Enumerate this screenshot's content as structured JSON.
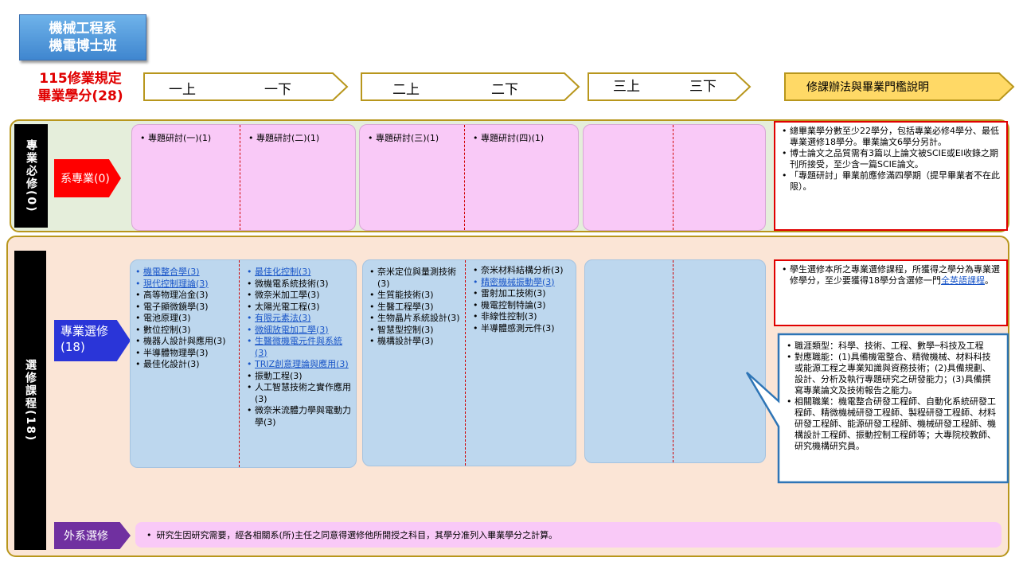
{
  "title": {
    "line1": "機械工程系",
    "line2": "機電博士班"
  },
  "credits_title": {
    "line1": "115修業規定",
    "line2": "畢業學分(28)"
  },
  "headers": {
    "year1": {
      "first": "一上",
      "second": "一下"
    },
    "year2": {
      "first": "二上",
      "second": "二下"
    },
    "year3": {
      "first": "三上",
      "second": "三下"
    },
    "notes": "修課辦法與畢業門檻說明"
  },
  "required": {
    "side_label": "專業必修(0)",
    "dept_tab": "系專業(0)",
    "y1_first": [
      "專題研討(一)(1)"
    ],
    "y1_second": [
      "專題研討(二)(1)"
    ],
    "y2_first": [
      "專題研討(三)(1)"
    ],
    "y2_second": [
      "專題研討(四)(1)"
    ],
    "notes": [
      "總畢業學分數至少22學分，包括專業必修4學分、最低專業選修18學分。畢業論文6學分另計。",
      "博士論文之品質需有3篇以上論文被SCIE或EI收錄之期刊所接受，至少含一篇SCIE論文。",
      "「專題研討」畢業前應修滿四學期（提早畢業者不在此限）。"
    ]
  },
  "elective": {
    "side_label": "選修課程(18)",
    "pro_tab_line1": "專業選修",
    "pro_tab_line2": "(18)",
    "y1_first": [
      {
        "text": "機電整合學(3)",
        "link": true
      },
      {
        "text": "現代控制理論(3)",
        "link": true
      },
      {
        "text": "高等物理冶金(3)",
        "link": false
      },
      {
        "text": "電子顯微鏡學(3)",
        "link": false
      },
      {
        "text": "電池原理(3)",
        "link": false
      },
      {
        "text": "數位控制(3)",
        "link": false
      },
      {
        "text": "機器人設計與應用(3)",
        "link": false
      },
      {
        "text": "半導體物理學(3)",
        "link": false
      },
      {
        "text": "最佳化設計(3)",
        "link": false
      }
    ],
    "y1_second": [
      {
        "text": "最佳化控制(3)",
        "link": true
      },
      {
        "text": "微機電系統技術(3)",
        "link": false
      },
      {
        "text": "微奈米加工學(3)",
        "link": false
      },
      {
        "text": "太陽光電工程(3)",
        "link": false
      },
      {
        "text": "有限元素法(3)",
        "link": true
      },
      {
        "text": "微細放電加工學(3)",
        "link": true
      },
      {
        "text": "生醫微機電元件與系統(3)",
        "link": true
      },
      {
        "text": "TRIZ創意理論與應用(3)",
        "link": true
      },
      {
        "text": "振動工程(3)",
        "link": false
      },
      {
        "text": "人工智慧技術之實作應用(3)",
        "link": false
      },
      {
        "text": "微奈米流體力學與電動力學(3)",
        "link": false
      }
    ],
    "y2_first": [
      {
        "text": "奈米定位與量測技術(3)",
        "link": false
      },
      {
        "text": "生質能技術(3)",
        "link": false
      },
      {
        "text": "生醫工程學(3)",
        "link": false
      },
      {
        "text": "生物晶片系統設計(3)",
        "link": false
      },
      {
        "text": "智慧型控制(3)",
        "link": false
      },
      {
        "text": "機構設計學(3)",
        "link": false
      }
    ],
    "y2_second": [
      {
        "text": "奈米材料結構分析(3)",
        "link": false
      },
      {
        "text": "精密機械振動學(3)",
        "link": true
      },
      {
        "text": "雷射加工技術(3)",
        "link": false
      },
      {
        "text": "機電控制特論(3)",
        "link": false
      },
      {
        "text": "非線性控制(3)",
        "link": false
      },
      {
        "text": "半導體感測元件(3)",
        "link": false
      }
    ],
    "note_text": "學生選修本所之專業選修課程，所獲得之學分為專業選修學分，至少要獲得18學分含選修一門",
    "note_link": "全英語課程",
    "note_end": "。",
    "career": [
      "職涯類型：科學、技術、工程、數學─科技及工程",
      "對應職能：(1)具備機電整合、精微機械、材料科技或能源工程之專業知識與資務技術；(2)具備規劃、設計、分析及執行專題研究之研發能力；(3)具備撰寫專業論文及技術報告之能力。",
      "相關職業：機電整合研發工程師、自動化系統研發工程師、精微機械研發工程師、製程研發工程師、材料研發工程師、能源研發工程師、機械研發工程師、機構設計工程師、振動控制工程師等；大專院校教師、研究機構研究員。"
    ],
    "outside_tab": "外系選修",
    "outside_text": "研究生因研究需要，經各相關系(所)主任之同意得選修他所開授之科目，其學分准列入畢業學分之計算。"
  }
}
